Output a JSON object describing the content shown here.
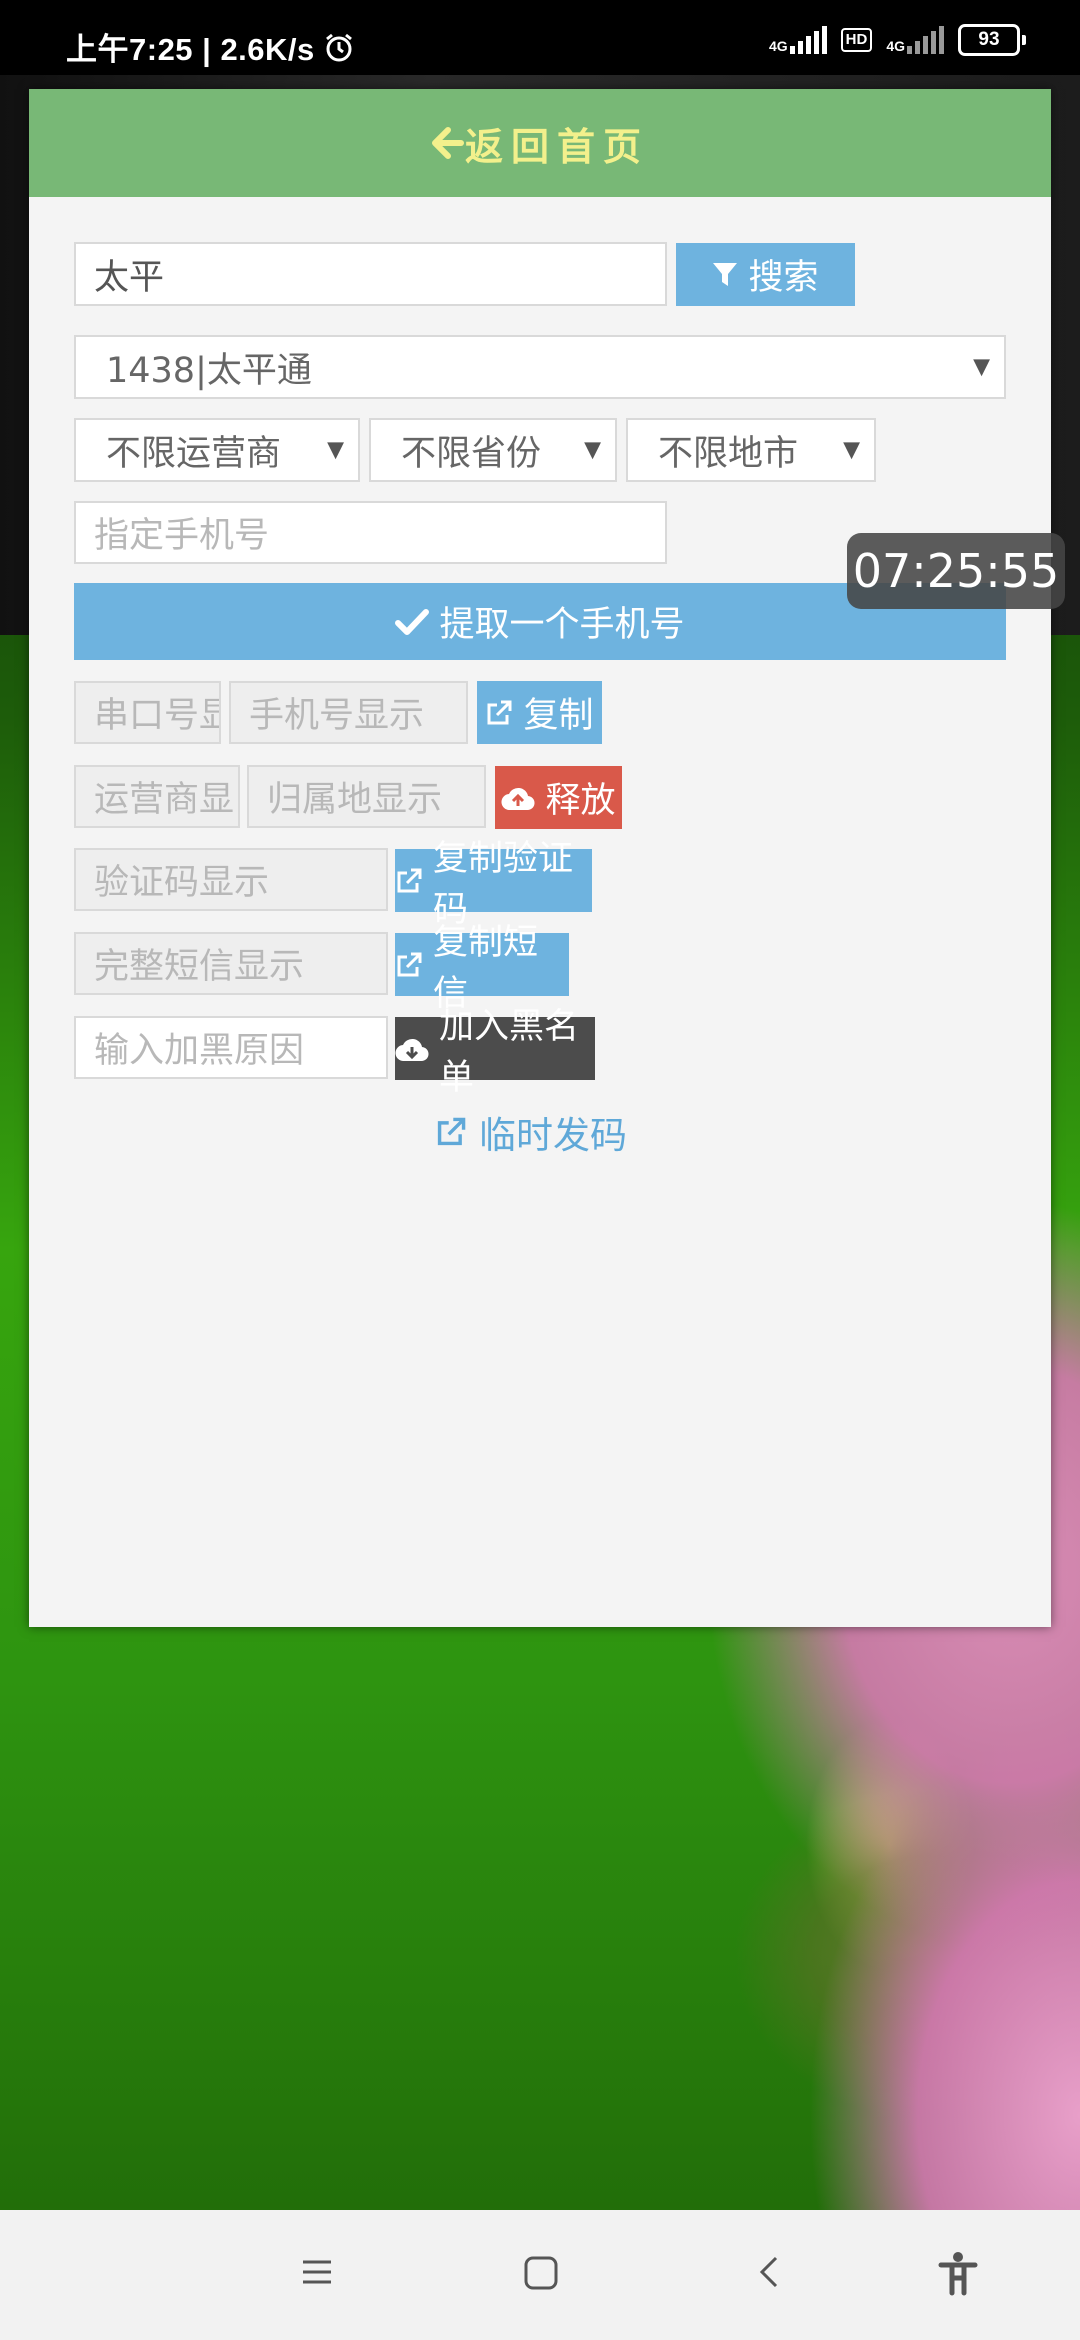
{
  "status_bar": {
    "time_text": "上午7:25 | 2.6K/s",
    "network_1": "4G",
    "hd": "HD",
    "network_2": "4G",
    "battery": "93"
  },
  "header": {
    "arrow": "➜",
    "title": "返回首页"
  },
  "search": {
    "value": "太平",
    "button_label": "搜索"
  },
  "project_select": {
    "value": "1438|太平通"
  },
  "filters": {
    "carrier": "不限运营商",
    "province": "不限省份",
    "city": "不限地市"
  },
  "phone_input": {
    "placeholder": "指定手机号"
  },
  "fetch_button": {
    "label": "提取一个手机号"
  },
  "rows": {
    "serial_placeholder": "串口号显",
    "phone_placeholder": "手机号显示",
    "copy_label": "复制",
    "carrier_placeholder": "运营商显:",
    "location_placeholder": "归属地显示",
    "release_label": "释放",
    "code_placeholder": "验证码显示",
    "copy_code_label": "复制验证码",
    "sms_placeholder": "完整短信显示",
    "copy_sms_label": "复制短信",
    "blacklist_reason_placeholder": "输入加黑原因",
    "blacklist_label": "加入黑名单"
  },
  "temp_link": {
    "label": "临时发码"
  },
  "floating_clock": {
    "time": "07:25:55"
  },
  "colors": {
    "header_bg": "#78b876",
    "header_text": "#f3f08c",
    "primary": "#6eb3df",
    "danger": "#d9594a",
    "dark": "#4c4c4c"
  }
}
